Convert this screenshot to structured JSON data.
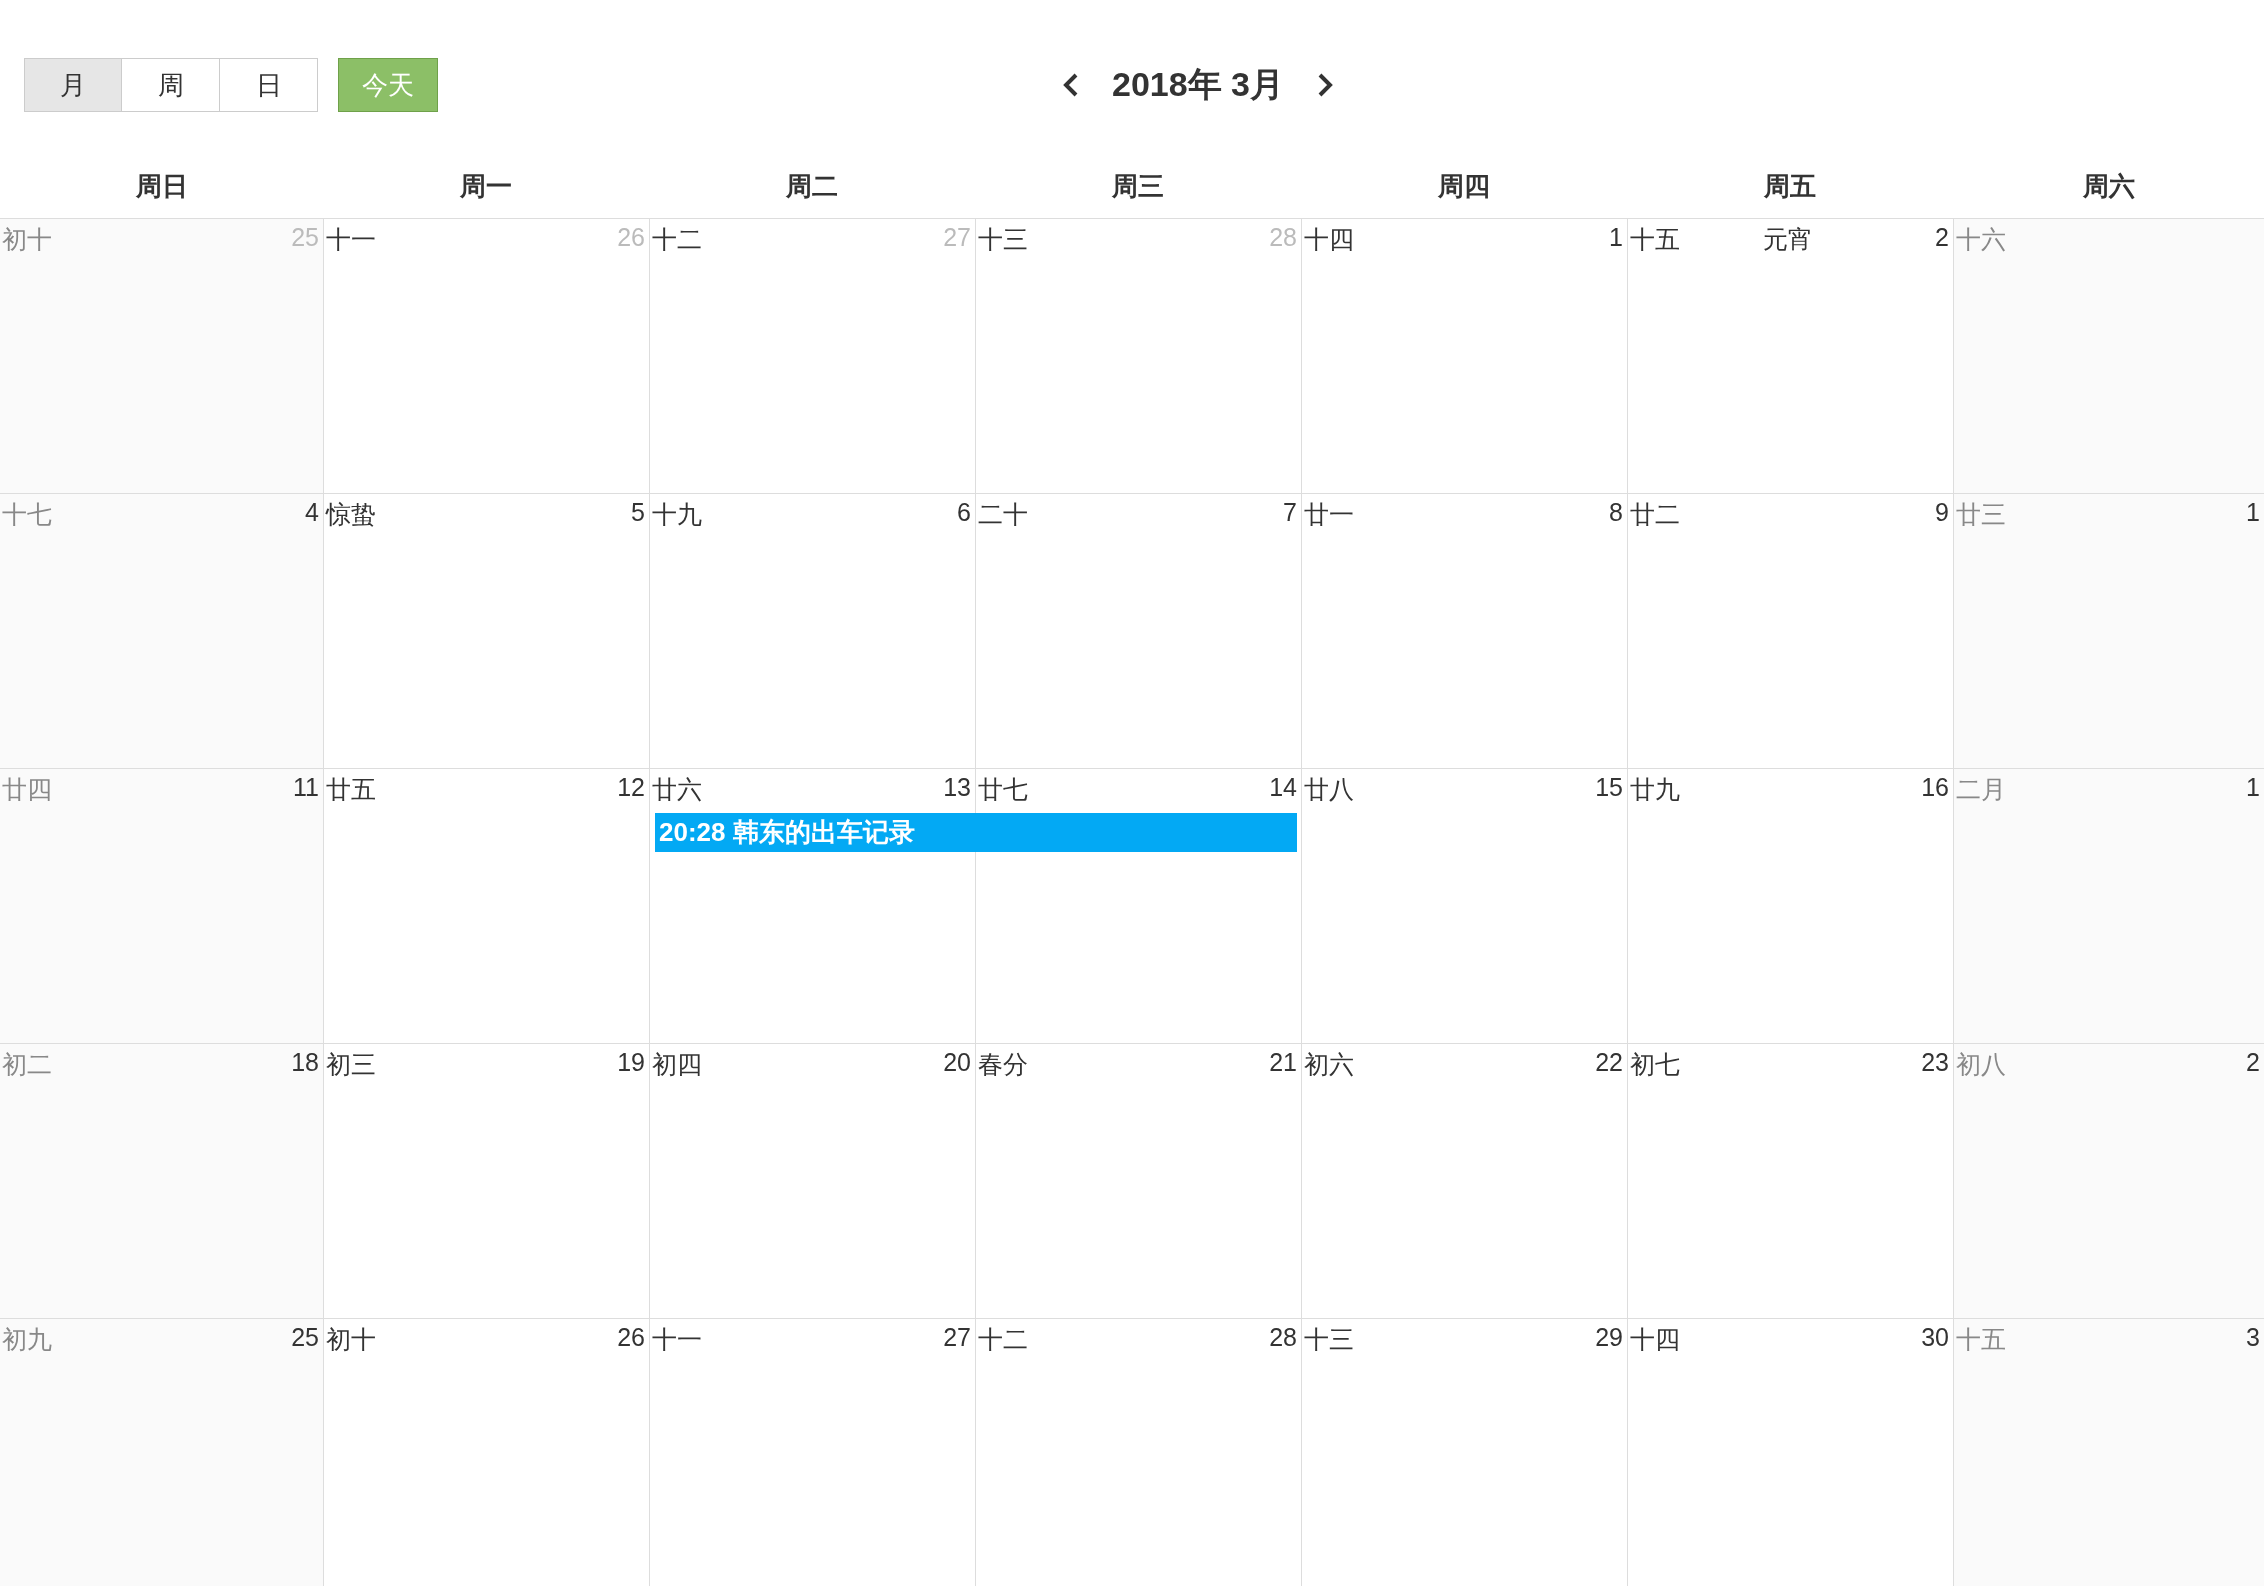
{
  "toolbar": {
    "views": [
      {
        "label": "月",
        "selected": true
      },
      {
        "label": "周",
        "selected": false
      },
      {
        "label": "日",
        "selected": false
      }
    ],
    "today": "今天",
    "title": "2018年 3月"
  },
  "weekdays": [
    "周日",
    "周一",
    "周二",
    "周三",
    "周四",
    "周五",
    "周六"
  ],
  "weeks": [
    {
      "days": [
        {
          "lunar": "初十",
          "day": "25",
          "other_month": true
        },
        {
          "lunar": "十一",
          "day": "26",
          "other_month": true
        },
        {
          "lunar": "十二",
          "day": "27",
          "other_month": true
        },
        {
          "lunar": "十三",
          "day": "28",
          "other_month": true
        },
        {
          "lunar": "十四",
          "day": "1",
          "other_month": false
        },
        {
          "lunar": "十五",
          "festival": "元宵",
          "day": "2",
          "other_month": false
        },
        {
          "lunar": "十六"
        }
      ]
    },
    {
      "days": [
        {
          "lunar": "十七",
          "day": "4",
          "other_month": false
        },
        {
          "lunar": "惊蛰",
          "day": "5",
          "other_month": false
        },
        {
          "lunar": "十九",
          "day": "6",
          "other_month": false
        },
        {
          "lunar": "二十",
          "day": "7",
          "other_month": false
        },
        {
          "lunar": "廿一",
          "day": "8",
          "other_month": false
        },
        {
          "lunar": "廿二",
          "day": "9",
          "other_month": false
        },
        {
          "lunar": "廿三",
          "day": "1",
          "other_month": false
        }
      ]
    },
    {
      "days": [
        {
          "lunar": "廿四",
          "day": "11",
          "other_month": false
        },
        {
          "lunar": "廿五",
          "day": "12",
          "other_month": false
        },
        {
          "lunar": "廿六",
          "day": "13",
          "other_month": false,
          "event": "20:28 韩东的出车记录"
        },
        {
          "lunar": "廿七",
          "day": "14",
          "other_month": false,
          "event_continues": true
        },
        {
          "lunar": "廿八",
          "day": "15",
          "other_month": false
        },
        {
          "lunar": "廿九",
          "day": "16",
          "other_month": false
        },
        {
          "lunar": "二月",
          "day": "1",
          "other_month": false
        }
      ]
    },
    {
      "days": [
        {
          "lunar": "初二",
          "day": "18",
          "other_month": false
        },
        {
          "lunar": "初三",
          "day": "19",
          "other_month": false
        },
        {
          "lunar": "初四",
          "day": "20",
          "other_month": false
        },
        {
          "lunar": "春分",
          "day": "21",
          "other_month": false
        },
        {
          "lunar": "初六",
          "day": "22",
          "other_month": false
        },
        {
          "lunar": "初七",
          "day": "23",
          "other_month": false
        },
        {
          "lunar": "初八",
          "day": "2",
          "other_month": false
        }
      ]
    },
    {
      "days": [
        {
          "lunar": "初九",
          "day": "25",
          "other_month": false
        },
        {
          "lunar": "初十",
          "day": "26",
          "other_month": false
        },
        {
          "lunar": "十一",
          "day": "27",
          "other_month": false
        },
        {
          "lunar": "十二",
          "day": "28",
          "other_month": false
        },
        {
          "lunar": "十三",
          "day": "29",
          "other_month": false
        },
        {
          "lunar": "十四",
          "day": "30",
          "other_month": false
        },
        {
          "lunar": "十五",
          "day": "3",
          "other_month": false
        }
      ]
    }
  ]
}
